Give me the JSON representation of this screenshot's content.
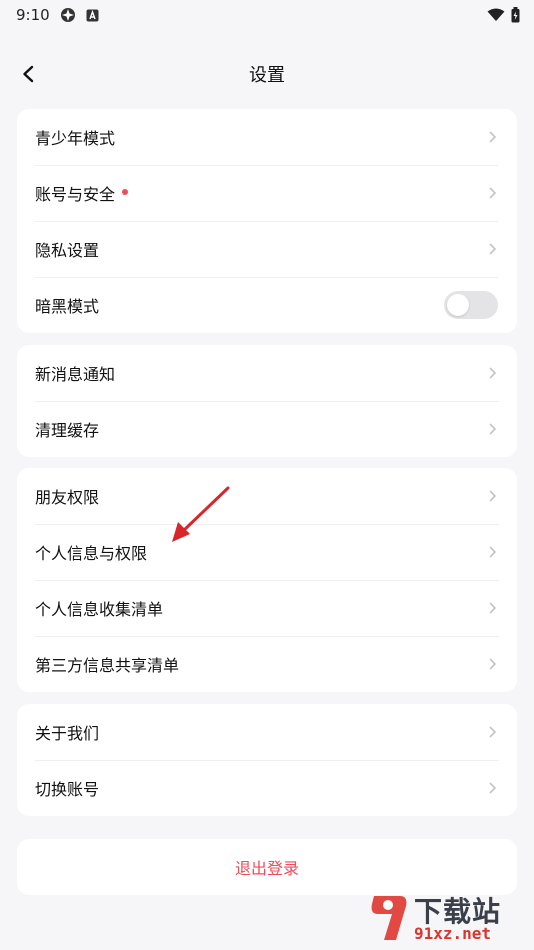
{
  "status_bar": {
    "time": "9:10"
  },
  "header": {
    "title": "设置"
  },
  "groups": [
    {
      "items": [
        {
          "label": "青少年模式"
        },
        {
          "label": "账号与安全"
        },
        {
          "label": "隐私设置"
        },
        {
          "label": "暗黑模式",
          "toggle_on": false
        }
      ]
    },
    {
      "items": [
        {
          "label": "新消息通知"
        },
        {
          "label": "清理缓存"
        }
      ]
    },
    {
      "items": [
        {
          "label": "朋友权限"
        },
        {
          "label": "个人信息与权限"
        },
        {
          "label": "个人信息收集清单"
        },
        {
          "label": "第三方信息共享清单"
        }
      ]
    },
    {
      "items": [
        {
          "label": "关于我们"
        },
        {
          "label": "切换账号"
        }
      ]
    }
  ],
  "logout": {
    "label": "退出登录"
  },
  "watermark": {
    "main": "下载站",
    "sub": "91xz.net"
  },
  "colors": {
    "accent_red": "#f04b5a",
    "background": "#f6f6f8",
    "card": "#ffffff",
    "chevron": "#c4c4c8"
  }
}
